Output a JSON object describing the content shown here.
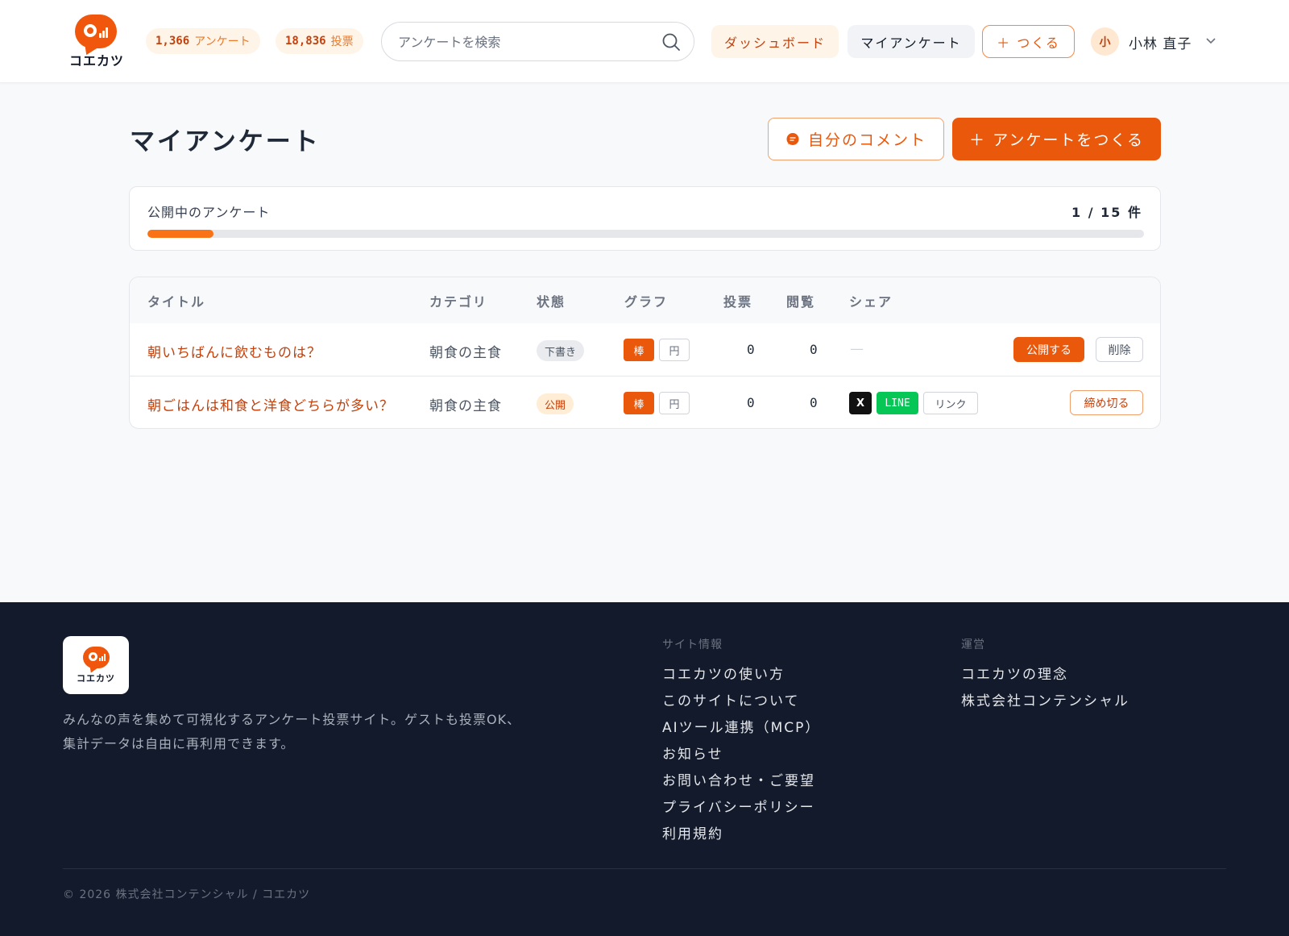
{
  "header": {
    "logo_text": "コエカツ",
    "stats": [
      {
        "value": "1,366",
        "unit": "アンケート"
      },
      {
        "value": "18,836",
        "unit": "投票"
      }
    ],
    "search_placeholder": "アンケートを検索",
    "nav": {
      "dashboard": "ダッシュボード",
      "my_surveys": "マイアンケート",
      "create": "＋ つくる"
    },
    "user": {
      "avatar_initial": "小",
      "name": "小林 直子"
    }
  },
  "main": {
    "title": "マイアンケート",
    "comment_button": "自分のコメント",
    "create_button": "＋ アンケートをつくる",
    "quota": {
      "label": "公開中のアンケート",
      "count_text": "1 / 15 件",
      "used": 1,
      "limit": 15
    },
    "table": {
      "headers": [
        "タイトル",
        "カテゴリ",
        "状態",
        "グラフ",
        "投票",
        "閲覧",
        "シェア"
      ],
      "rows": [
        {
          "title": "朝いちばんに飲むものは？",
          "category": "朝食の主食",
          "status": "下書き",
          "graph_bar": "棒",
          "graph_pie": "円",
          "votes": "0",
          "views": "0",
          "share_none": "—",
          "actions": [
            "公開する",
            "削除"
          ]
        },
        {
          "title": "朝ごはんは和食と洋食どちらが多い？",
          "category": "朝食の主食",
          "status": "公開",
          "graph_bar": "棒",
          "graph_pie": "円",
          "votes": "0",
          "views": "0",
          "share": [
            "X",
            "LINE",
            "リンク"
          ],
          "actions": [
            "締め切る"
          ]
        }
      ]
    }
  },
  "footer": {
    "logo_text": "コエカツ",
    "description": "みんなの声を集めて可視化するアンケート投票サイト。ゲストも投票OK、集計データは自由に再利用できます。",
    "site_info": {
      "title": "サイト情報",
      "links": [
        "コエカツの使い方",
        "このサイトについて",
        "AIツール連携（MCP）",
        "お知らせ",
        "お問い合わせ・ご要望",
        "プライバシーポリシー",
        "利用規約"
      ]
    },
    "operation": {
      "title": "運営",
      "links": [
        "コエカツの理念",
        "株式会社コンテンシャル"
      ]
    },
    "copyright": "© 2026 株式会社コンテンシャル / コエカツ"
  },
  "colors": {
    "accent": "#ea580c",
    "footer_bg": "#121a2b",
    "line_green": "#06c755"
  }
}
